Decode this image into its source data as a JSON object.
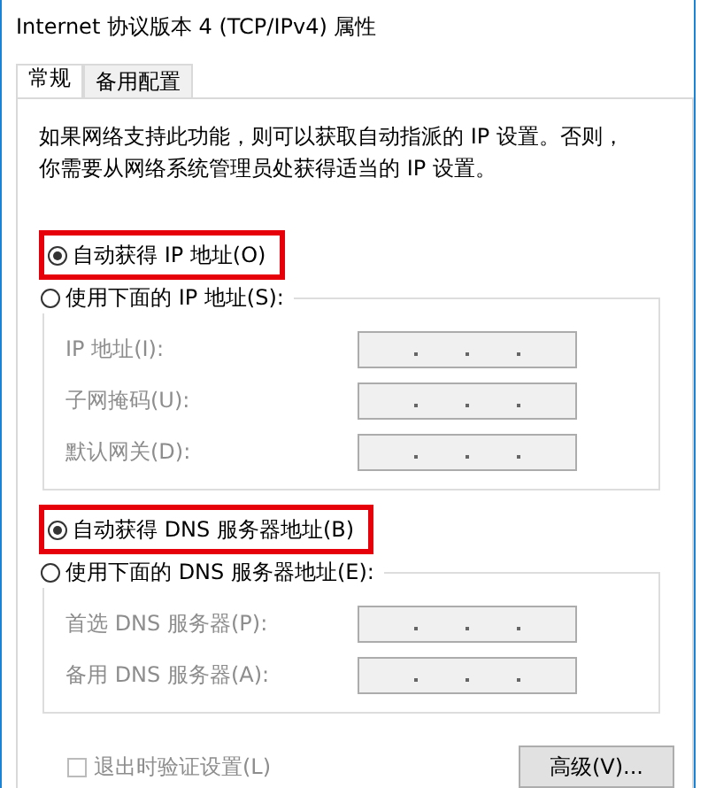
{
  "window": {
    "title": "Internet 协议版本 4 (TCP/IPv4) 属性"
  },
  "tabs": [
    {
      "label": "常规",
      "selected": true
    },
    {
      "label": "备用配置",
      "selected": false
    }
  ],
  "description": "如果网络支持此功能，则可以获取自动指派的 IP 设置。否则，你需要从网络系统管理员处获得适当的 IP 设置。",
  "sections": [
    {
      "auto_option": {
        "label": "自动获得 IP 地址(O)",
        "selected": true,
        "highlighted": true
      },
      "manual_option": {
        "label": "使用下面的 IP 地址(S):",
        "selected": false
      },
      "fields": [
        {
          "label": "IP 地址(I):",
          "disabled": true
        },
        {
          "label": "子网掩码(U):",
          "disabled": true
        },
        {
          "label": "默认网关(D):",
          "disabled": true
        }
      ]
    },
    {
      "auto_option": {
        "label": "自动获得 DNS 服务器地址(B)",
        "selected": true,
        "highlighted": true
      },
      "manual_option": {
        "label": "使用下面的 DNS 服务器地址(E):",
        "selected": false
      },
      "fields": [
        {
          "label": "首选 DNS 服务器(P):",
          "disabled": true
        },
        {
          "label": "备用 DNS 服务器(A):",
          "disabled": true
        }
      ]
    }
  ],
  "validate_checkbox": {
    "label": "退出时验证设置(L)",
    "checked": false,
    "disabled": true
  },
  "advanced_button": {
    "label": "高级(V)..."
  }
}
